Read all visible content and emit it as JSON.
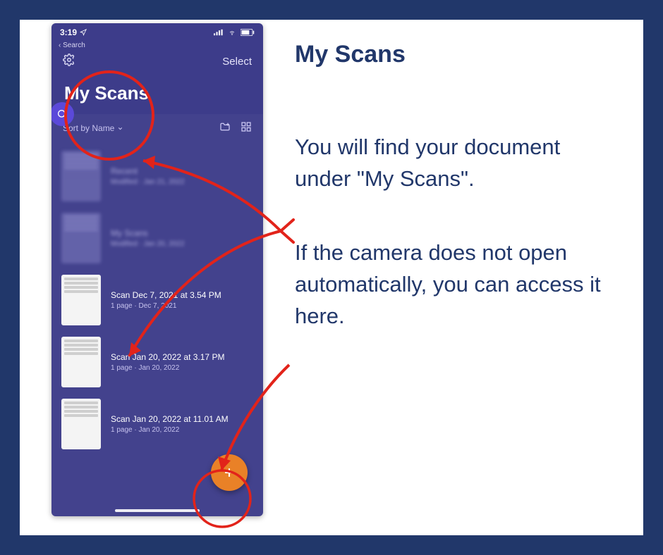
{
  "guide": {
    "heading": "My Scans",
    "para1": "You will find your document under \"My Scans\".",
    "para2": "If the camera does not open automatically, you can access it here."
  },
  "phone": {
    "status": {
      "time": "3:19"
    },
    "back_label": "Search",
    "select_label": "Select",
    "title": "My Scans",
    "sort_label": "Sort by Name",
    "items": [
      {
        "title": "Recent",
        "sub": "Modified · Jan 21, 2022",
        "blurred": true,
        "dim_thumb": true
      },
      {
        "title": "My Scans",
        "sub": "Modified · Jan 20, 2022",
        "blurred": true,
        "dim_thumb": true
      },
      {
        "title": "Scan Dec 7, 2021 at 3.54 PM",
        "sub": "1 page · Dec 7, 2021",
        "blurred": false,
        "dim_thumb": false
      },
      {
        "title": "Scan Jan 20, 2022 at 3.17 PM",
        "sub": "1 page · Jan 20, 2022",
        "blurred": false,
        "dim_thumb": false
      },
      {
        "title": "Scan Jan 20, 2022 at 11.01 AM",
        "sub": "1 page · Jan 20, 2022",
        "blurred": false,
        "dim_thumb": false
      }
    ],
    "fab_label": "Add scan"
  },
  "colors": {
    "frame": "#21376a",
    "phone_bg": "#3d3c8a",
    "accent_orange": "#e98127",
    "annotation": "#e2231a"
  }
}
